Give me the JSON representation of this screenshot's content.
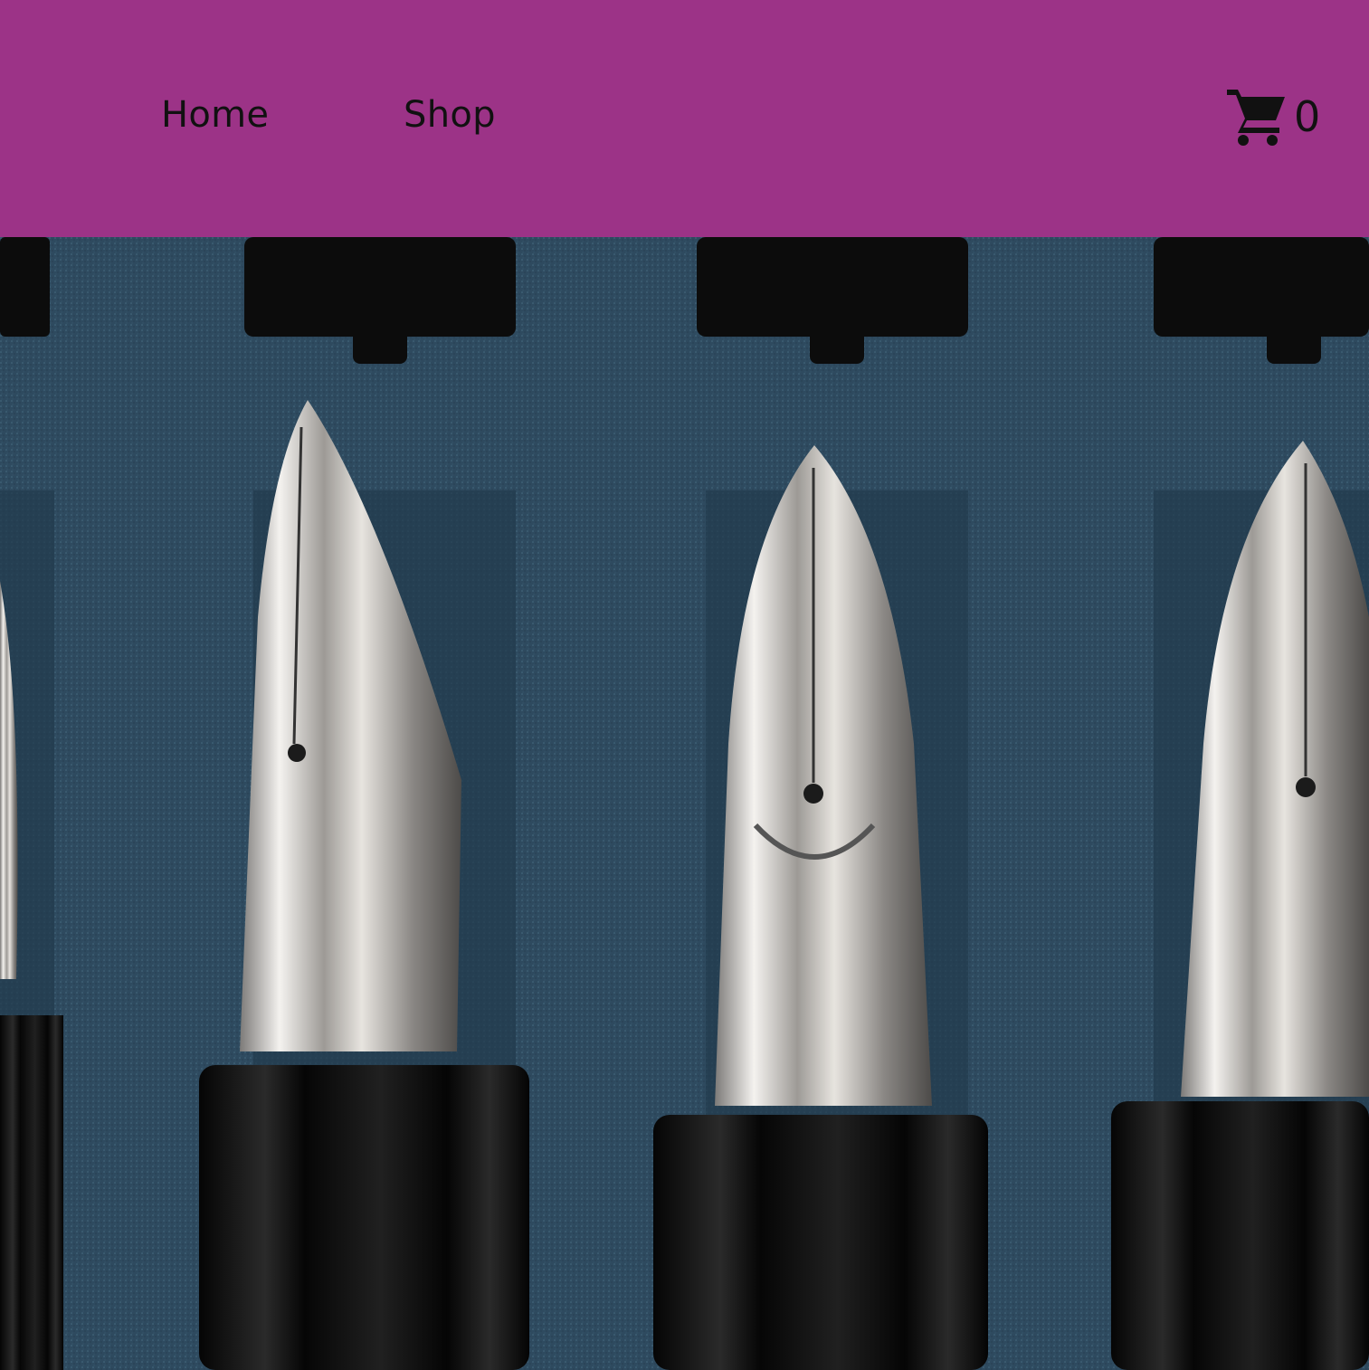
{
  "nav": {
    "home_label": "Home",
    "shop_label": "Shop"
  },
  "cart": {
    "icon": "shopping-cart-icon",
    "count": "0"
  },
  "hero": {
    "subject": "fountain-pen-nibs-photo"
  },
  "colors": {
    "header_bg": "#9c3387",
    "nav_text": "#111111",
    "velvet": "#2d4a60",
    "barrel": "#0b0b0b",
    "nib_silver": "#d9d6d2"
  }
}
